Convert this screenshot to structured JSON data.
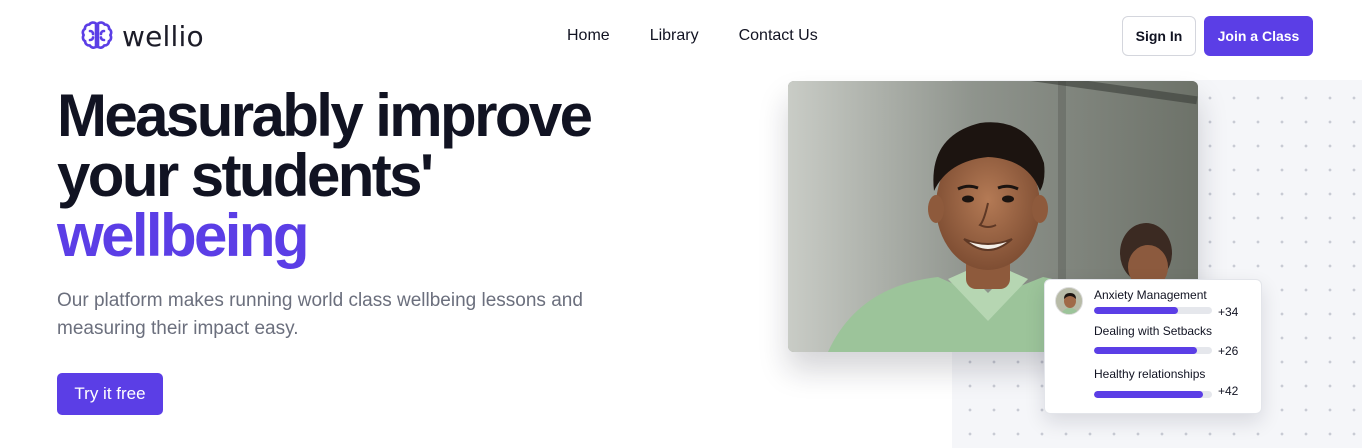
{
  "brand": {
    "name": "wellio",
    "accent_color": "#5b3ee6",
    "logo_icon": "brain-icon"
  },
  "nav": {
    "items": [
      "Home",
      "Library",
      "Contact Us"
    ]
  },
  "header": {
    "signin_label": "Sign In",
    "join_label": "Join a Class"
  },
  "hero": {
    "headline_line1": "Measurably improve",
    "headline_line2": "your students'",
    "headline_accent": "wellbeing",
    "subtitle": "Our platform makes running world class wellbeing lessons and measuring their impact easy.",
    "cta_label": "Try it free"
  },
  "stats_card": {
    "items": [
      {
        "label": "Anxiety Management",
        "value": "+34",
        "progress": 0.71
      },
      {
        "label": "Dealing with Setbacks",
        "value": "+26",
        "progress": 0.87
      },
      {
        "label": "Healthy relationships",
        "value": "+42",
        "progress": 0.92
      }
    ]
  }
}
